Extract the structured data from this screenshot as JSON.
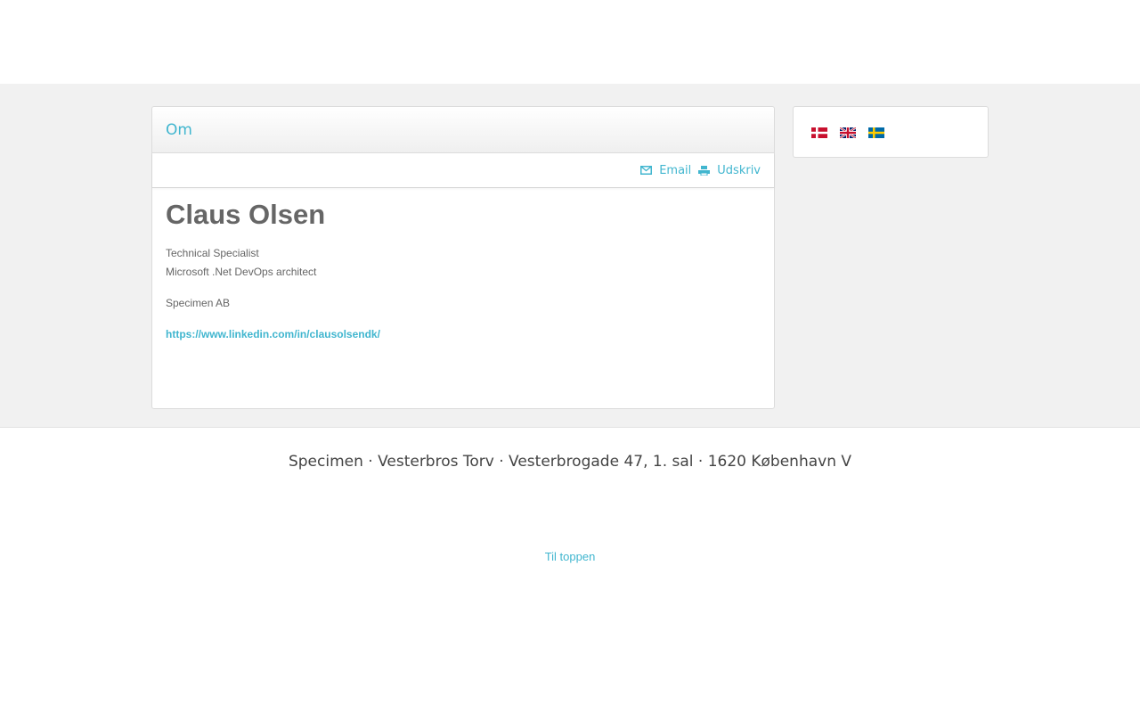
{
  "panel": {
    "title": "Om",
    "tools": {
      "email_label": "Email",
      "print_label": "Udskriv"
    }
  },
  "profile": {
    "name": "Claus Olsen",
    "title_line1": "Technical Specialist",
    "title_line2": "Microsoft .Net DevOps architect",
    "company": "Specimen AB",
    "link": "https://www.linkedin.com/in/clausolsendk/"
  },
  "languages": [
    {
      "name": "danish-flag-icon"
    },
    {
      "name": "english-flag-icon"
    },
    {
      "name": "swedish-flag-icon"
    }
  ],
  "footer": {
    "address": "Specimen · Vesterbros Torv · Vesterbrogade 47, 1. sal · 1620 København V",
    "to_top": "Til toppen"
  },
  "colors": {
    "accent": "#41b6cf",
    "band": "#f1f1f1",
    "text": "#666666"
  }
}
